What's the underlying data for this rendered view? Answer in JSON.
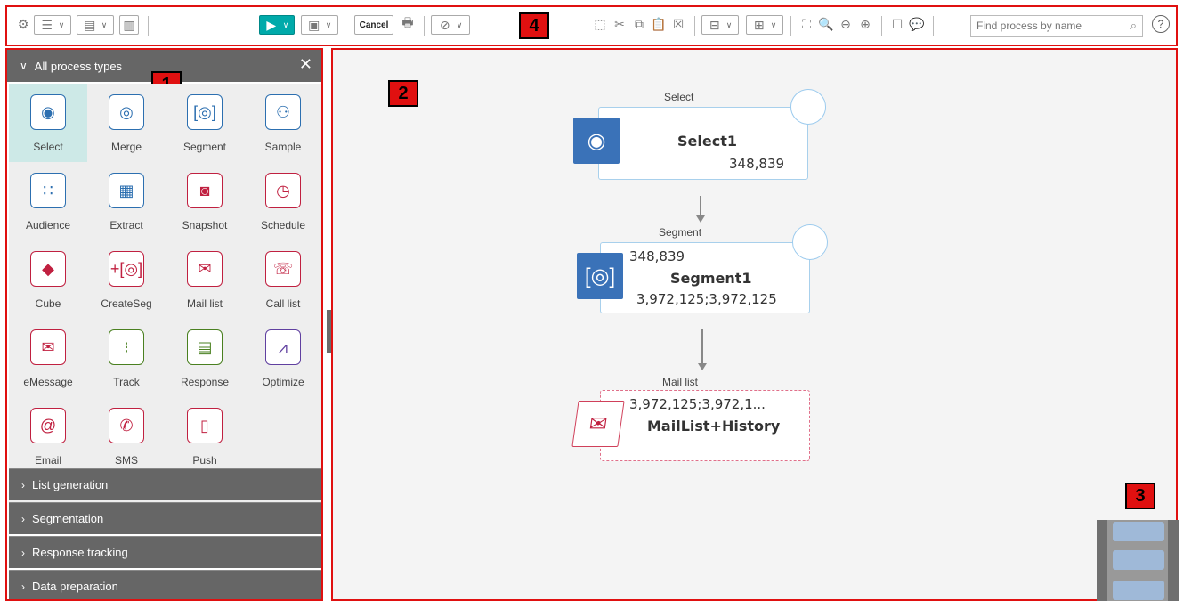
{
  "toolbar": {
    "cancel_label": "Cancel",
    "search_placeholder": "Find process by name"
  },
  "callouts": [
    "1",
    "2",
    "3",
    "4"
  ],
  "palette": {
    "header": "All process types",
    "tools": [
      {
        "label": "Select",
        "icon": "select-icon",
        "color": "blue",
        "selected": true
      },
      {
        "label": "Merge",
        "icon": "merge-icon",
        "color": "blue"
      },
      {
        "label": "Segment",
        "icon": "segment-icon",
        "color": "blue"
      },
      {
        "label": "Sample",
        "icon": "sample-icon",
        "color": "blue"
      },
      {
        "label": "Audience",
        "icon": "audience-icon",
        "color": "blue"
      },
      {
        "label": "Extract",
        "icon": "extract-icon",
        "color": "blue"
      },
      {
        "label": "Snapshot",
        "icon": "snapshot-icon",
        "color": "red"
      },
      {
        "label": "Schedule",
        "icon": "schedule-icon",
        "color": "red"
      },
      {
        "label": "Cube",
        "icon": "cube-icon",
        "color": "red"
      },
      {
        "label": "CreateSeg",
        "icon": "createseg-icon",
        "color": "red"
      },
      {
        "label": "Mail list",
        "icon": "mail-list-icon",
        "color": "red"
      },
      {
        "label": "Call list",
        "icon": "call-list-icon",
        "color": "red"
      },
      {
        "label": "eMessage",
        "icon": "emessage-icon",
        "color": "red"
      },
      {
        "label": "Track",
        "icon": "track-icon",
        "color": "grn"
      },
      {
        "label": "Response",
        "icon": "response-icon",
        "color": "grn"
      },
      {
        "label": "Optimize",
        "icon": "optimize-icon",
        "color": "pur"
      },
      {
        "label": "Email",
        "icon": "email-icon",
        "color": "red"
      },
      {
        "label": "SMS",
        "icon": "sms-icon",
        "color": "red"
      },
      {
        "label": "Push",
        "icon": "push-icon",
        "color": "red"
      }
    ],
    "sections": [
      "List generation",
      "Segmentation",
      "Response tracking",
      "Data preparation"
    ]
  },
  "canvas": {
    "nodes": [
      {
        "type": "Select",
        "title": "Select1",
        "count": "348,839"
      },
      {
        "type": "Segment",
        "title": "Segment1",
        "count_top": "348,839",
        "count": "3,972,125;3,972,125"
      },
      {
        "type": "Mail list",
        "title": "MailList+History",
        "count_top": "3,972,125;3,972,1..."
      }
    ]
  }
}
